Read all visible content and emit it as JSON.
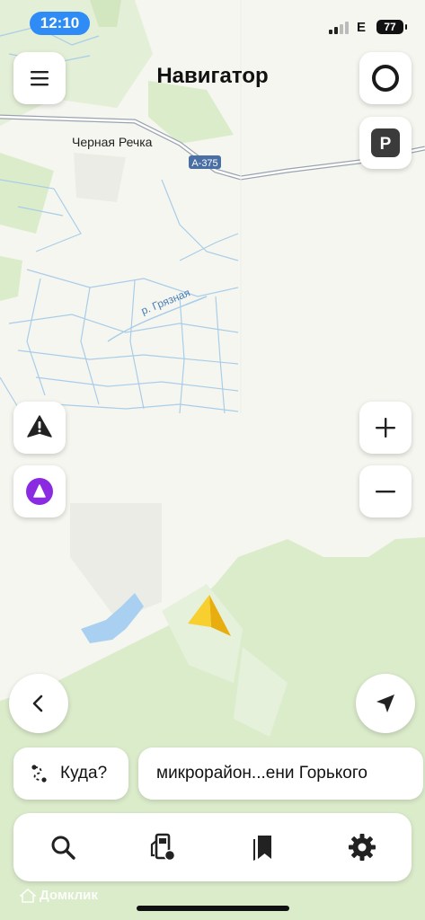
{
  "status": {
    "time": "12:10",
    "network": "E",
    "battery": "77"
  },
  "header": {
    "title": "Навигатор"
  },
  "map": {
    "labels": {
      "village": "Черная Речка",
      "road": "А-375",
      "river": "р. Грязная"
    }
  },
  "actions": {
    "destination_label": "Куда?",
    "current_location": "микрорайон...ени Горького"
  },
  "bottom_nav": [
    "search-icon",
    "fuel-icon",
    "bookmarks-icon",
    "settings-icon"
  ],
  "watermark": "Домклик",
  "colors": {
    "accent": "#2f8cf6",
    "alice": "#8a2be2",
    "cursor": "#f4c21a",
    "forest": "#dbeccb",
    "water": "#a9d0f0"
  }
}
